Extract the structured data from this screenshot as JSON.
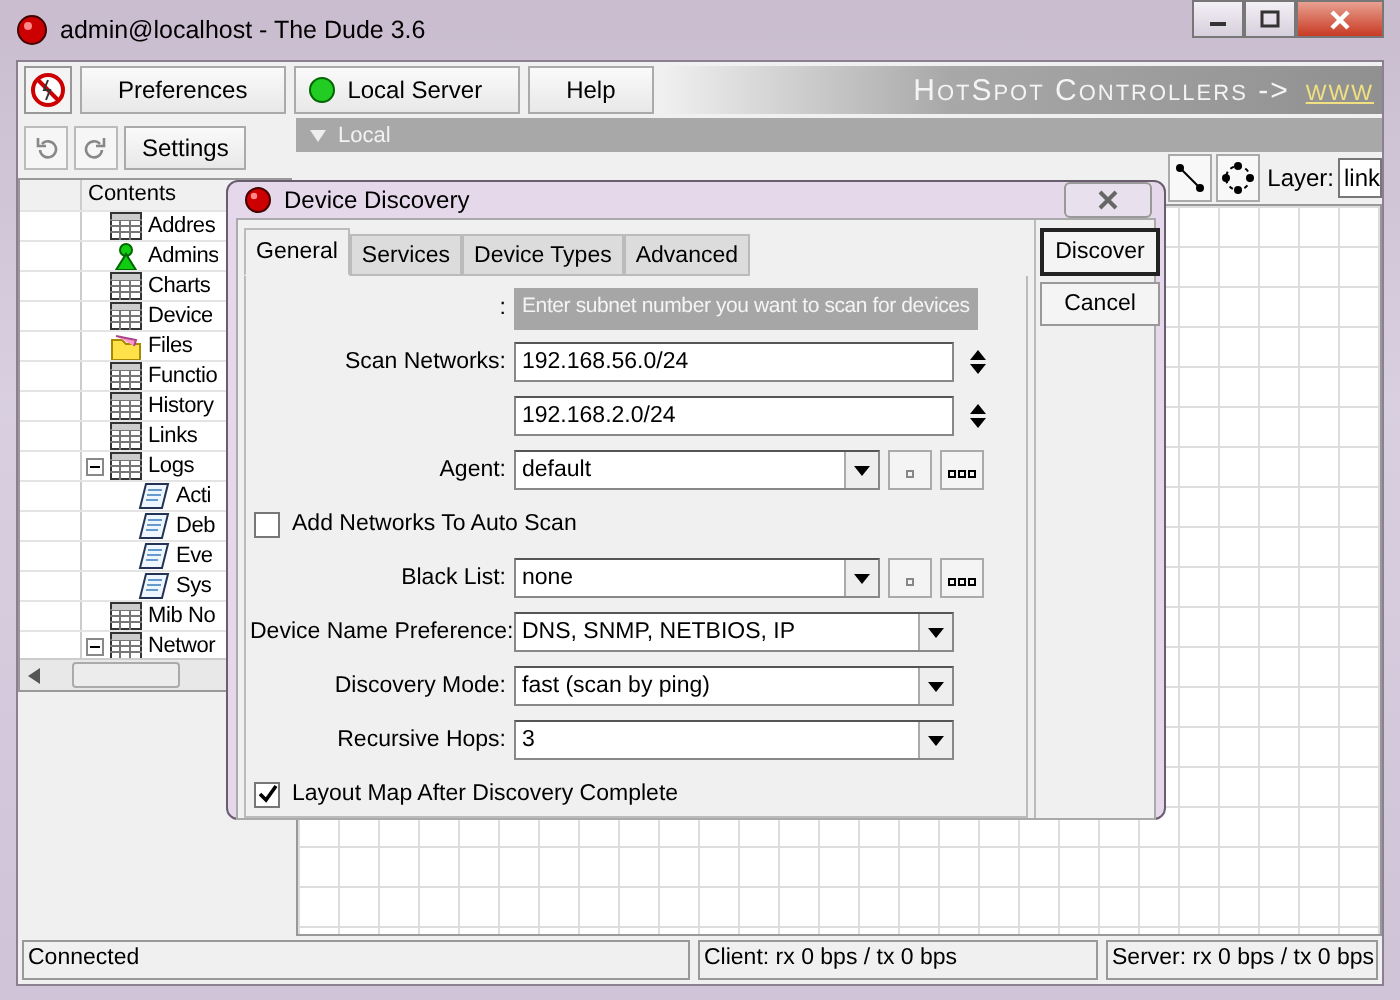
{
  "window": {
    "title": "admin@localhost - The Dude 3.6"
  },
  "toolbar": {
    "buttons": [
      {
        "kind": "icon"
      },
      {
        "kind": "text",
        "label": "Preferences"
      },
      {
        "kind": "status",
        "label": "Local Server"
      },
      {
        "kind": "text",
        "label": "Help"
      }
    ],
    "banner": "HotSpot Controllers ->",
    "banner_link": "www"
  },
  "secondary_toolbar": {
    "settings": "Settings"
  },
  "panel": {
    "title": "Local",
    "layer_label": "Layer:",
    "layer_value": "link"
  },
  "tree": {
    "header": "Contents",
    "items": [
      {
        "label": "Addres",
        "kind": "table"
      },
      {
        "label": "Admins",
        "kind": "person"
      },
      {
        "label": "Charts",
        "kind": "table"
      },
      {
        "label": "Device",
        "kind": "table"
      },
      {
        "label": "Files",
        "kind": "folder"
      },
      {
        "label": "Functio",
        "kind": "table"
      },
      {
        "label": "History",
        "kind": "table"
      },
      {
        "label": "Links",
        "kind": "table"
      },
      {
        "label": "Logs",
        "kind": "table",
        "expanded": true,
        "children": [
          {
            "label": "Acti",
            "kind": "log"
          },
          {
            "label": "Deb",
            "kind": "log"
          },
          {
            "label": "Eve",
            "kind": "log"
          },
          {
            "label": "Sys",
            "kind": "log"
          }
        ]
      },
      {
        "label": "Mib No",
        "kind": "table"
      },
      {
        "label": "Networ",
        "kind": "table",
        "expanded": true
      }
    ]
  },
  "dialog": {
    "title": "Device Discovery",
    "tabs": [
      {
        "label": "General",
        "selected": true
      },
      {
        "label": "Services",
        "selected": false
      },
      {
        "label": "Device Types",
        "selected": false
      },
      {
        "label": "Advanced",
        "selected": false
      }
    ],
    "rows": [
      {
        "kind": "hint",
        "label": ":",
        "text": "Enter subnet number you want to scan for devices"
      },
      {
        "kind": "spin",
        "label": "Scan Networks:",
        "value": "192.168.56.0/24"
      },
      {
        "kind": "spin",
        "value": "192.168.2.0/24"
      },
      {
        "kind": "combo",
        "label": "Agent:",
        "value": "default"
      },
      {
        "kind": "checkbox",
        "label": "Add Networks To Auto Scan",
        "checked": false
      },
      {
        "kind": "combo",
        "label": "Black List:",
        "value": "none"
      },
      {
        "kind": "select",
        "label": "Device Name Preference:",
        "value": "DNS, SNMP, NETBIOS, IP"
      },
      {
        "kind": "select",
        "label": "Discovery Mode:",
        "value": "fast (scan by ping)"
      },
      {
        "kind": "select",
        "label": "Recursive Hops:",
        "value": "3"
      },
      {
        "kind": "checkbox",
        "label": "Layout Map After Discovery Complete",
        "checked": true
      }
    ],
    "buttons": [
      {
        "label": "Discover",
        "default": true
      },
      {
        "label": "Cancel",
        "default": false
      }
    ]
  },
  "status_bar": [
    "Connected",
    "Client: rx 0 bps / tx 0 bps",
    "Server: rx 0 bps / tx 0 bps"
  ]
}
